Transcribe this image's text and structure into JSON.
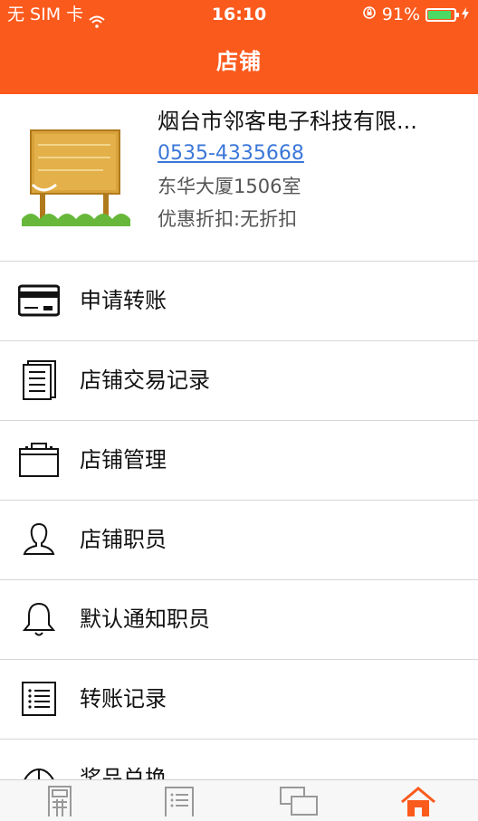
{
  "status_bar": {
    "carrier": "无 SIM 卡",
    "time": "16:10",
    "battery_percent": "91%",
    "battery_level": 0.91,
    "icons": [
      "wifi-icon",
      "rotation-lock-icon",
      "battery-icon",
      "charging-icon"
    ]
  },
  "header": {
    "title": "店铺"
  },
  "shop": {
    "name": "烟台市邻客电子科技有限...",
    "phone": "0535-4335668",
    "address": "东华大厦1506室",
    "discount": "优惠折扣:无折扣",
    "image": "shop-sign-photo"
  },
  "menu": {
    "items": [
      {
        "label": "申请转账",
        "icon": "card-icon"
      },
      {
        "label": "店铺交易记录",
        "icon": "document-icon"
      },
      {
        "label": "店铺管理",
        "icon": "briefcase-icon"
      },
      {
        "label": "店铺职员",
        "icon": "person-icon"
      },
      {
        "label": "默认通知职员",
        "icon": "bell-icon"
      },
      {
        "label": "转账记录",
        "icon": "list-icon"
      },
      {
        "label": "奖品兑换",
        "icon": "gift-icon"
      }
    ]
  },
  "tabbar": {
    "tabs": [
      {
        "icon": "calculator-icon"
      },
      {
        "icon": "list-icon"
      },
      {
        "icon": "chat-icon"
      },
      {
        "icon": "home-icon"
      }
    ],
    "active_index": 3
  },
  "colors": {
    "brand": "#fb5a1d",
    "link": "#3b77d8",
    "battery": "#4cd964"
  }
}
